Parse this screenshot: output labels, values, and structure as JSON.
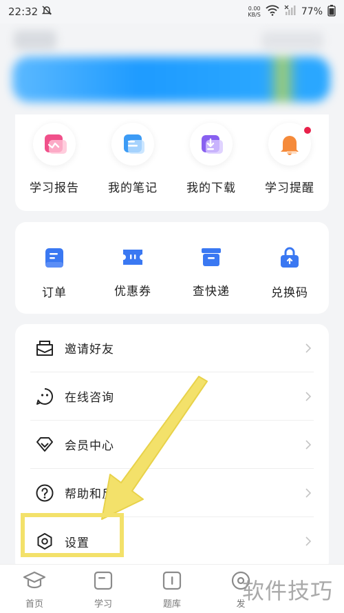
{
  "status_bar": {
    "time": "22:32",
    "net_speed_value": "0.00",
    "net_speed_unit": "KB/S",
    "battery": "77%"
  },
  "learning_tools": [
    {
      "label": "学习报告",
      "icon": "report-icon",
      "color": "#f0508a"
    },
    {
      "label": "我的笔记",
      "icon": "notes-icon",
      "color": "#3c9bf5"
    },
    {
      "label": "我的下载",
      "icon": "download-icon",
      "color": "#8860f0"
    },
    {
      "label": "学习提醒",
      "icon": "bell-icon",
      "color": "#f58a3a",
      "has_badge": true
    }
  ],
  "order_tools": [
    {
      "label": "订单",
      "icon": "order-icon"
    },
    {
      "label": "优惠券",
      "icon": "coupon-icon"
    },
    {
      "label": "查快递",
      "icon": "delivery-icon"
    },
    {
      "label": "兑换码",
      "icon": "redeem-code-icon"
    }
  ],
  "menu_items": [
    {
      "label": "邀请好友",
      "icon": "invite-icon"
    },
    {
      "label": "在线咨询",
      "icon": "chat-face-icon"
    },
    {
      "label": "会员中心",
      "icon": "diamond-icon"
    },
    {
      "label": "帮助和反馈",
      "icon": "help-icon"
    },
    {
      "label": "设置",
      "icon": "settings-icon"
    }
  ],
  "bottom_nav": [
    {
      "label": "首页",
      "icon": "graduation-cap-icon"
    },
    {
      "label": "学习",
      "icon": "study-icon"
    },
    {
      "label": "题库",
      "icon": "question-bank-icon"
    },
    {
      "label": "发",
      "icon": "discover-icon"
    }
  ],
  "watermark": "软件技巧",
  "colors": {
    "accent_blue": "#3a78f2",
    "highlight_yellow": "#f3e16a"
  }
}
